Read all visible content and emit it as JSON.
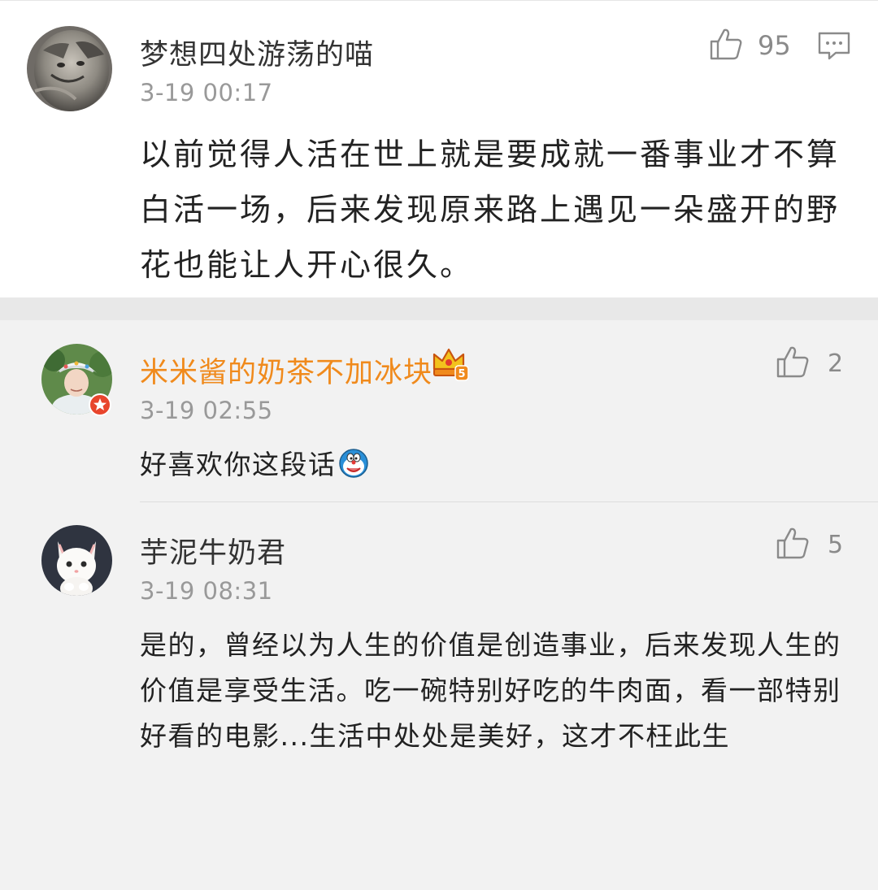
{
  "main_comment": {
    "username": "梦想四处游荡的喵",
    "timestamp": "3-19 00:17",
    "content": "以前觉得人活在世上就是要成就一番事业才不算白活一场，后来发现原来路上遇见一朵盛开的野花也能让人开心很久。",
    "likes": "95"
  },
  "replies": [
    {
      "username": "米米酱的奶茶不加冰块",
      "timestamp": "3-19 02:55",
      "content": "好喜欢你这段话",
      "likes": "2"
    },
    {
      "username": "芋泥牛奶君",
      "timestamp": "3-19 08:31",
      "content": "是的，曾经以为人生的价值是创造事业，后来发现人生的价值是享受生活。吃一碗特别好吃的牛肉面，看一部特别好看的电影...生活中处处是美好，这才不枉此生",
      "likes": "5"
    }
  ],
  "colors": {
    "vip_username": "#f08a1c",
    "meta_gray": "#999999",
    "reply_background": "#f2f2f2"
  },
  "icons": {
    "like": "thumbs-up-icon",
    "comment": "comment-bubble-icon",
    "vip": "crown-vip-badge",
    "emoji": "doraemon-emoji"
  }
}
